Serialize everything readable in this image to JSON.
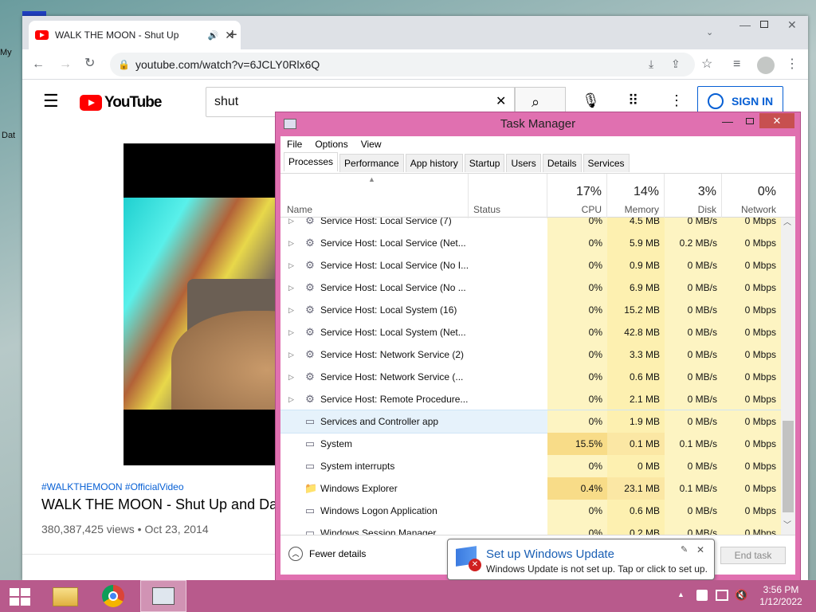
{
  "desktop": {
    "icon_labels": [
      "My",
      "Dat"
    ]
  },
  "browser": {
    "tab_title": "WALK THE MOON - Shut Up",
    "new_tab": "+",
    "url": "youtube.com/watch?v=6JCLY0Rlx6Q",
    "youtube": {
      "logo_text": "YouTube",
      "search_value": "shut",
      "sign_in": "SIGN IN",
      "hashtags": "#WALKTHEMOON #OfficialVideo",
      "video_title": "WALK THE MOON - Shut Up and Dance",
      "views": "380,387,425 views",
      "date": "Oct 23, 2014",
      "separator": "•"
    }
  },
  "task_manager": {
    "title": "Task Manager",
    "menu": [
      "File",
      "Options",
      "View"
    ],
    "tabs": [
      "Processes",
      "Performance",
      "App history",
      "Startup",
      "Users",
      "Details",
      "Services"
    ],
    "columns": {
      "name": "Name",
      "status": "Status",
      "cpu": {
        "pct": "17%",
        "label": "CPU"
      },
      "memory": {
        "pct": "14%",
        "label": "Memory"
      },
      "disk": {
        "pct": "3%",
        "label": "Disk"
      },
      "network": {
        "pct": "0%",
        "label": "Network"
      }
    },
    "rows": [
      {
        "name": "Service Host: Local Service (7)",
        "cpu": "0%",
        "mem": "4.5 MB",
        "disk": "0 MB/s",
        "net": "0 Mbps",
        "icon": "gear-icon",
        "expandable": true
      },
      {
        "name": "Service Host: Local Service (Net...",
        "cpu": "0%",
        "mem": "5.9 MB",
        "disk": "0.2 MB/s",
        "net": "0 Mbps",
        "icon": "gear-icon",
        "expandable": true
      },
      {
        "name": "Service Host: Local Service (No I...",
        "cpu": "0%",
        "mem": "0.9 MB",
        "disk": "0 MB/s",
        "net": "0 Mbps",
        "icon": "gear-icon",
        "expandable": true
      },
      {
        "name": "Service Host: Local Service (No ...",
        "cpu": "0%",
        "mem": "6.9 MB",
        "disk": "0 MB/s",
        "net": "0 Mbps",
        "icon": "gear-icon",
        "expandable": true
      },
      {
        "name": "Service Host: Local System (16)",
        "cpu": "0%",
        "mem": "15.2 MB",
        "disk": "0 MB/s",
        "net": "0 Mbps",
        "icon": "gear-icon",
        "expandable": true
      },
      {
        "name": "Service Host: Local System (Net...",
        "cpu": "0%",
        "mem": "42.8 MB",
        "disk": "0 MB/s",
        "net": "0 Mbps",
        "icon": "gear-icon",
        "expandable": true
      },
      {
        "name": "Service Host: Network Service (2)",
        "cpu": "0%",
        "mem": "3.3 MB",
        "disk": "0 MB/s",
        "net": "0 Mbps",
        "icon": "gear-icon",
        "expandable": true
      },
      {
        "name": "Service Host: Network Service (...",
        "cpu": "0%",
        "mem": "0.6 MB",
        "disk": "0 MB/s",
        "net": "0 Mbps",
        "icon": "gear-icon",
        "expandable": true
      },
      {
        "name": "Service Host: Remote Procedure...",
        "cpu": "0%",
        "mem": "2.1 MB",
        "disk": "0 MB/s",
        "net": "0 Mbps",
        "icon": "gear-icon",
        "expandable": true
      },
      {
        "name": "Services and Controller app",
        "cpu": "0%",
        "mem": "1.9 MB",
        "disk": "0 MB/s",
        "net": "0 Mbps",
        "icon": "window-icon",
        "expandable": false,
        "selected": true
      },
      {
        "name": "System",
        "cpu": "15.5%",
        "mem": "0.1 MB",
        "disk": "0.1 MB/s",
        "net": "0 Mbps",
        "icon": "window-icon",
        "expandable": false,
        "hot": true
      },
      {
        "name": "System interrupts",
        "cpu": "0%",
        "mem": "0 MB",
        "disk": "0 MB/s",
        "net": "0 Mbps",
        "icon": "window-icon",
        "expandable": false
      },
      {
        "name": "Windows Explorer",
        "cpu": "0.4%",
        "mem": "23.1 MB",
        "disk": "0.1 MB/s",
        "net": "0 Mbps",
        "icon": "folder-icon",
        "expandable": false,
        "warm": true
      },
      {
        "name": "Windows Logon Application",
        "cpu": "0%",
        "mem": "0.6 MB",
        "disk": "0 MB/s",
        "net": "0 Mbps",
        "icon": "window-icon",
        "expandable": false
      },
      {
        "name": "Windows Session Manager",
        "cpu": "0%",
        "mem": "0.2 MB",
        "disk": "0 MB/s",
        "net": "0 Mbps",
        "icon": "window-icon",
        "expandable": false
      }
    ],
    "fewer_details": "Fewer details",
    "end_task": "End task"
  },
  "toast": {
    "title": "Set up Windows Update",
    "message": "Windows Update is not set up. Tap or click to set up."
  },
  "taskbar": {
    "time": "3:56 PM",
    "date": "1/12/2022"
  }
}
